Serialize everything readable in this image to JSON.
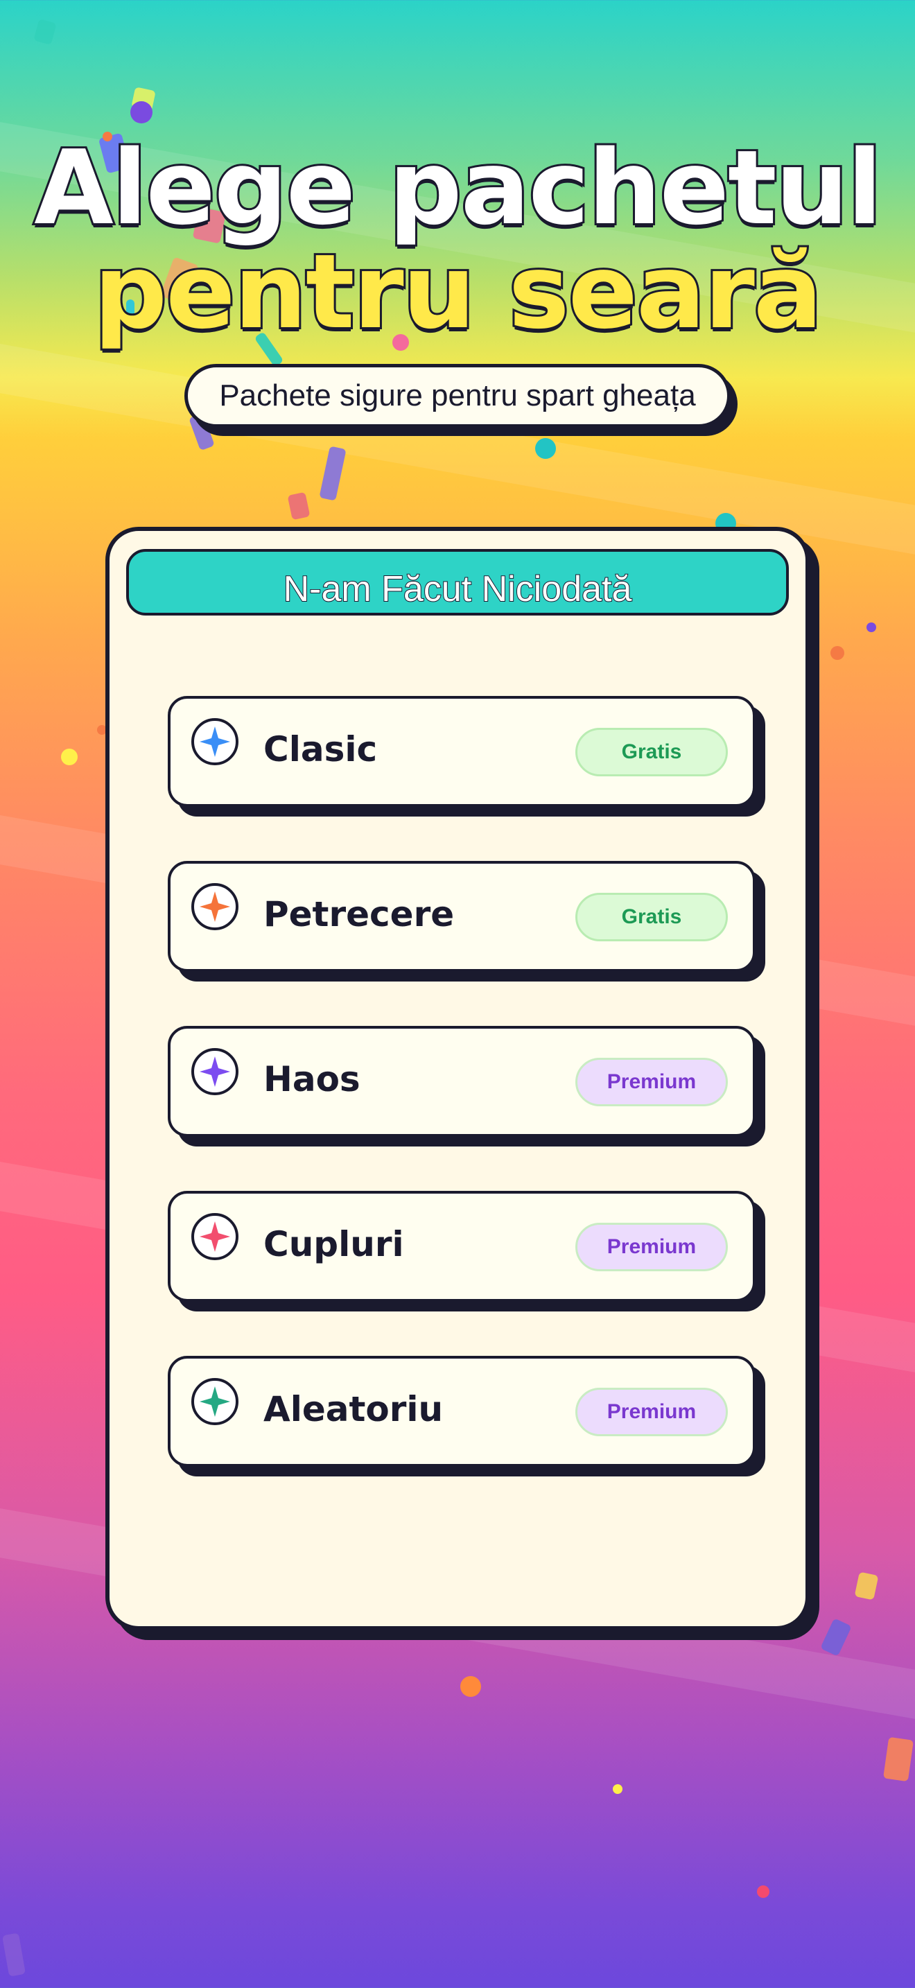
{
  "header": {
    "title_line1": "Alege pachetul",
    "title_line2": "pentru seară",
    "subtitle": "Pachete sigure pentru spart gheața"
  },
  "game": {
    "name": "N-am Făcut Niciodată"
  },
  "packs": [
    {
      "label": "Clasic",
      "badge": "Gratis",
      "tier": "free",
      "icon": "sparkle-icon",
      "color": "#3a8ef6"
    },
    {
      "label": "Petrecere",
      "badge": "Gratis",
      "tier": "free",
      "icon": "sparkle-icon",
      "color": "#f5733a"
    },
    {
      "label": "Haos",
      "badge": "Premium",
      "tier": "premium",
      "icon": "sparkle-icon",
      "color": "#7c4cf0"
    },
    {
      "label": "Cupluri",
      "badge": "Premium",
      "tier": "premium",
      "icon": "sparkle-icon",
      "color": "#f24e6e"
    },
    {
      "label": "Aleatoriu",
      "badge": "Premium",
      "tier": "premium",
      "icon": "sparkle-icon",
      "color": "#25a883"
    }
  ],
  "colors": {
    "outline": "#1a1a2e",
    "header_accent": "#2ed3c6",
    "title_yellow": "#ffe94a",
    "free_text": "#1d9a55",
    "premium_text": "#7a38cf"
  }
}
